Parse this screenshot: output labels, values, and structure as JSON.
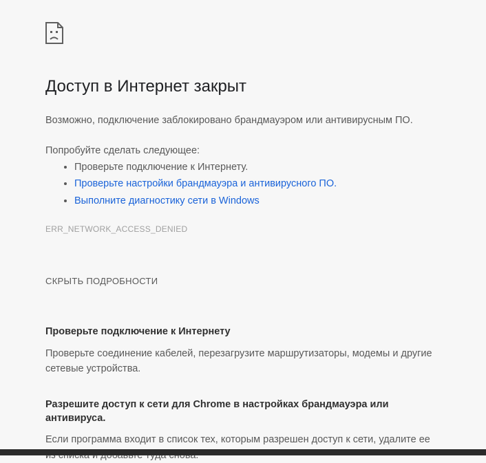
{
  "heading": "Доступ в Интернет закрыт",
  "message": "Возможно, подключение заблокировано брандмауэром или антивирусным ПО.",
  "try_label": "Попробуйте сделать следующее:",
  "suggestions": {
    "item0": "Проверьте подключение к Интернету.",
    "item1": "Проверьте настройки брандмауэра и антивирусного ПО.",
    "item2": "Выполните диагностику сети в Windows"
  },
  "error_code": "ERR_NETWORK_ACCESS_DENIED",
  "details_toggle": "СКРЫТЬ ПОДРОБНОСТИ",
  "details": {
    "sect1_title": "Проверьте подключение к Интернету",
    "sect1_body": "Проверьте соединение кабелей, перезагрузите маршрутизаторы, модемы и другие сетевые устройства.",
    "sect2_title": "Разрешите доступ к сети для Chrome в настройках брандмауэра или антивируса.",
    "sect2_body": "Если программа входит в список тех, которым разрешен доступ к сети, удалите ее из списка и добавьте туда снова."
  }
}
